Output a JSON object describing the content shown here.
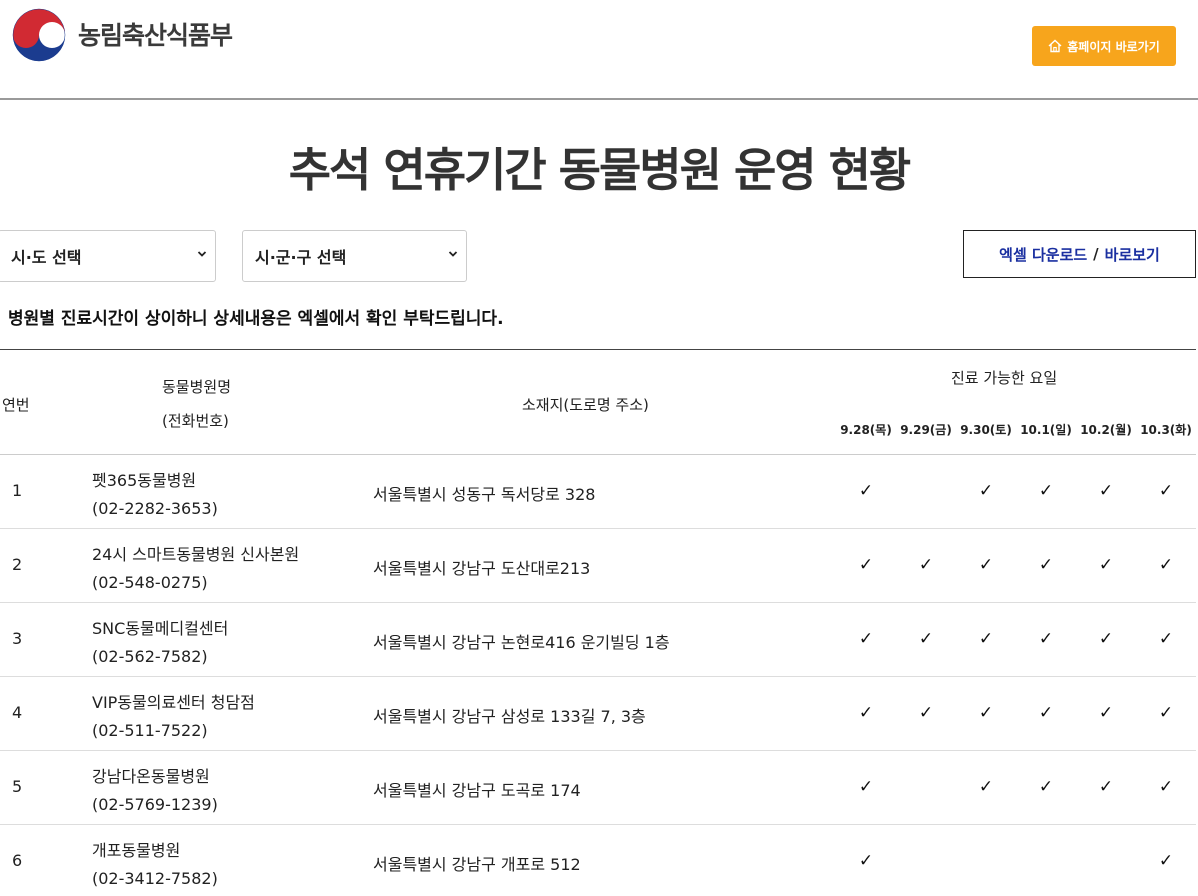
{
  "header": {
    "ministry_name": "농림축산식품부",
    "home_button_label": "홈페이지 바로가기",
    "accent": "#f7a51c"
  },
  "page_title": "추석 연휴기간 동물병원 운영 현황",
  "filters": {
    "province_select": "시·도 선택",
    "district_select": "시·군·구 선택",
    "excel_download": "엑셀 다운로드",
    "separator": "/",
    "view": "바로보기"
  },
  "notice": "병원별 진료시간이 상이하니 상세내용은 엑셀에서 확인 부탁드립니다.",
  "table": {
    "headers": {
      "no": "연번",
      "name": "동물병원명",
      "phone": "(전화번호)",
      "address": "소재지(도로명 주소)",
      "days_group": "진료 가능한 요일",
      "days": [
        "9.28(목)",
        "9.29(금)",
        "9.30(토)",
        "10.1(일)",
        "10.2(월)",
        "10.3(화)"
      ]
    },
    "check_mark": "✓",
    "rows": [
      {
        "no": "1",
        "name": "펫365동물병원",
        "phone": "(02-2282-3653)",
        "address": "서울특별시 성동구 독서당로 328",
        "days": [
          true,
          false,
          true,
          true,
          true,
          true
        ]
      },
      {
        "no": "2",
        "name": "24시 스마트동물병원 신사본원",
        "phone": "(02-548-0275)",
        "address": "서울특별시 강남구 도산대로213",
        "days": [
          true,
          true,
          true,
          true,
          true,
          true
        ]
      },
      {
        "no": "3",
        "name": "SNC동물메디컬센터",
        "phone": "(02-562-7582)",
        "address": "서울특별시 강남구 논현로416 운기빌딩 1층",
        "days": [
          true,
          true,
          true,
          true,
          true,
          true
        ]
      },
      {
        "no": "4",
        "name": "VIP동물의료센터 청담점",
        "phone": "(02-511-7522)",
        "address": "서울특별시 강남구 삼성로 133길 7, 3층",
        "days": [
          true,
          true,
          true,
          true,
          true,
          true
        ]
      },
      {
        "no": "5",
        "name": "강남다온동물병원",
        "phone": "(02-5769-1239)",
        "address": "서울특별시 강남구 도곡로 174",
        "days": [
          true,
          false,
          true,
          true,
          true,
          true
        ]
      },
      {
        "no": "6",
        "name": "개포동물병원",
        "phone": "(02-3412-7582)",
        "address": "서울특별시 강남구 개포로 512",
        "days": [
          true,
          false,
          false,
          false,
          false,
          true
        ]
      }
    ]
  }
}
